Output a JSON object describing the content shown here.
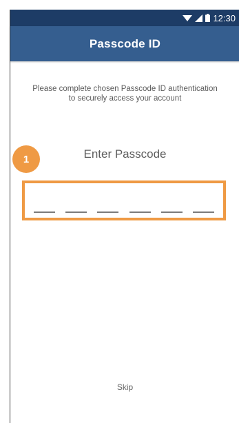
{
  "status_bar": {
    "time": "12:30",
    "icons": [
      "wifi-icon",
      "cellular-signal-icon",
      "battery-icon"
    ]
  },
  "app_bar": {
    "title": "Passcode ID"
  },
  "instructions": {
    "line1": "Please complete chosen Passcode ID authentication",
    "line2": "to securely access your account"
  },
  "passcode": {
    "label": "Enter Passcode",
    "digit_count": 6,
    "step_badge": "1"
  },
  "footer": {
    "skip_label": "Skip"
  },
  "colors": {
    "status_bar": "#1d3c66",
    "app_bar": "#355e8f",
    "highlight": "#ef9a44"
  }
}
